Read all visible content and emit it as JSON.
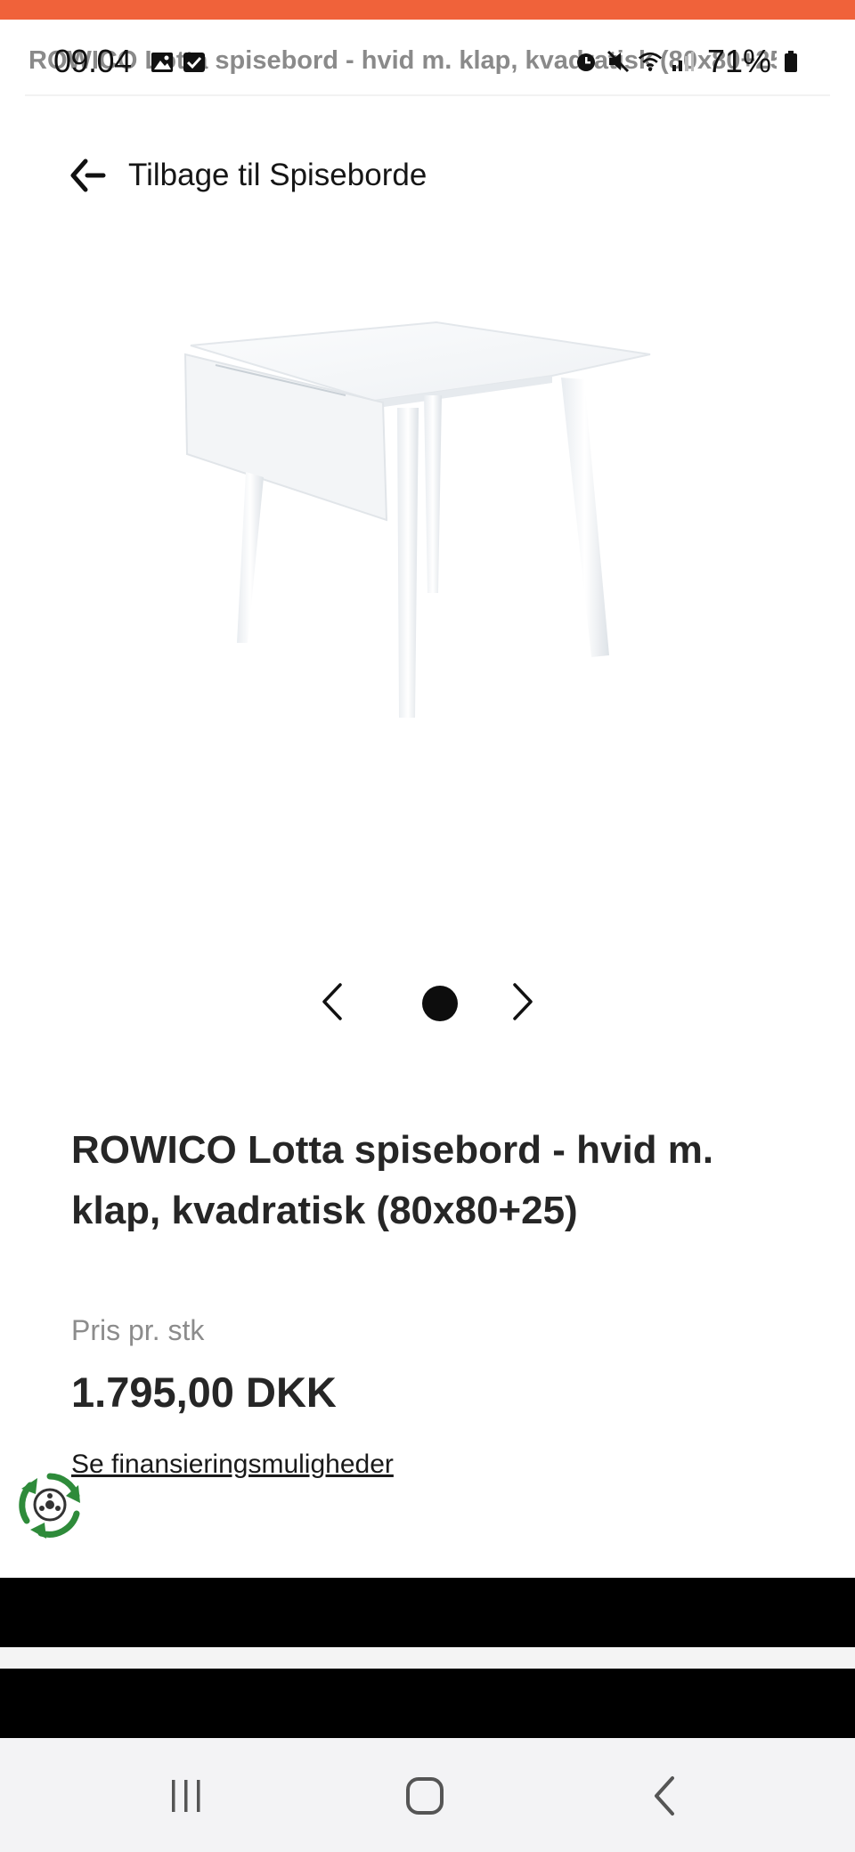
{
  "status_bar": {
    "page_title_ghost": "ROWICO Lotta spisebord - hvid m. klap, kvadratisk (80x80+25)",
    "time": "09.04",
    "battery": "71%"
  },
  "navigation": {
    "back_label": "Tilbage til Spiseborde"
  },
  "carousel": {
    "current_index": 1,
    "total": 1
  },
  "product": {
    "title": "ROWICO Lotta spisebord - hvid m. klap, kvadratisk (80x80+25)",
    "price_label": "Pris pr. stk",
    "price": "1.795,00 DKK",
    "finance_link": "Se finansieringsmuligheder"
  },
  "colors": {
    "accent": "#f0623a",
    "nav_bar_bg": "#f3f3f5",
    "recycle_badge": "#2e8b3a"
  },
  "icons": {
    "back": "arrow-left-icon",
    "carousel_prev": "chevron-left-icon",
    "carousel_next": "chevron-right-icon",
    "recycle": "recycle-icon",
    "nav_recent": "recent-apps-icon",
    "nav_home": "home-icon",
    "nav_back": "back-icon"
  }
}
